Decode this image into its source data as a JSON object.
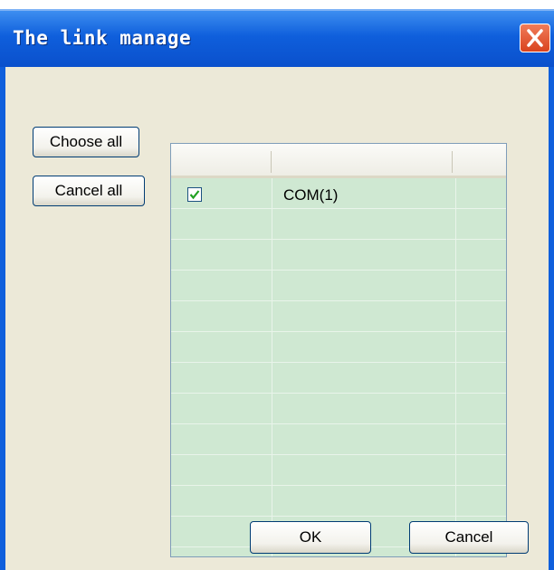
{
  "dialog": {
    "title": "The link manage",
    "choose_all_label": "Choose all",
    "cancel_all_label": "Cancel all",
    "ok_label": "OK",
    "cancel_label": "Cancel"
  },
  "table": {
    "rows": [
      {
        "checked": true,
        "name": "COM(1)"
      }
    ]
  },
  "colors": {
    "title_bar": "#0f5fdc",
    "close_button": "#d9431e",
    "grid_background": "#cfe8d2",
    "checkmark": "#21a121"
  },
  "icons": [
    "close-icon",
    "checkmark-icon"
  ]
}
